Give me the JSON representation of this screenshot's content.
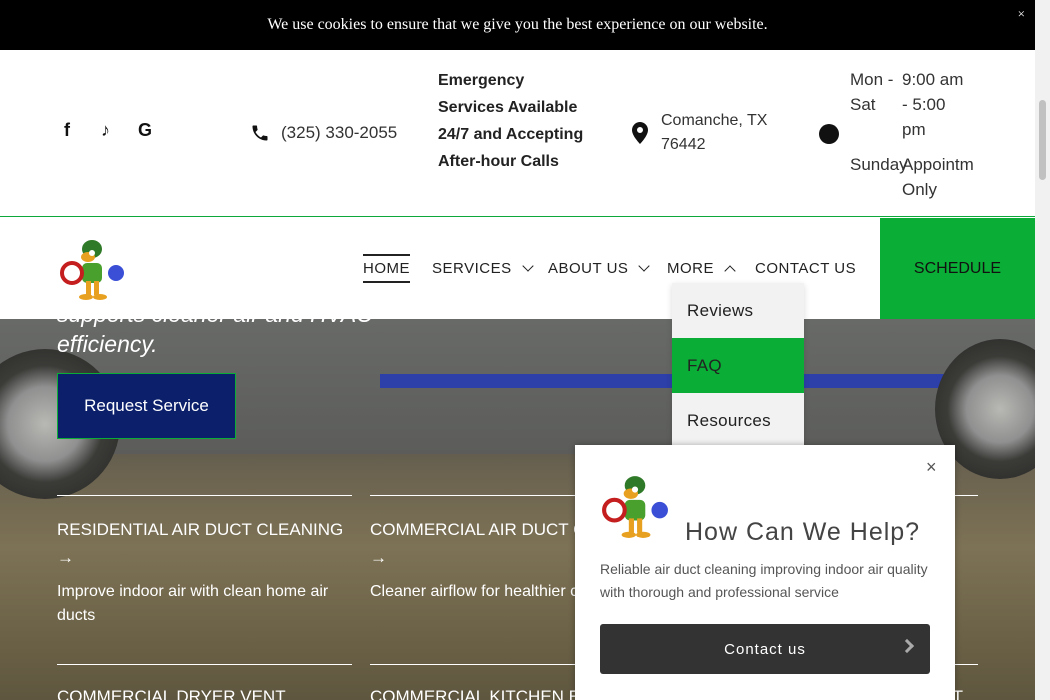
{
  "cookie": {
    "message": "We use cookies to ensure that we give you the best experience on our website.",
    "close": "×"
  },
  "info": {
    "social_icons": [
      "facebook-icon",
      "tiktok-icon",
      "google-icon"
    ],
    "social_glyphs": [
      "f",
      "♪",
      "G"
    ],
    "phone": "(325) 330-2055",
    "emergency": "Emergency Services Available 24/7 and Accepting After-hour Calls",
    "location": "Comanche, TX 76442",
    "hours": {
      "days1": "Mon - Sat",
      "time1": "9:00 am - 5:00 pm",
      "days2": "Sunday",
      "time2": "Appointm",
      "time2b": "Only"
    }
  },
  "nav": {
    "items": [
      {
        "label": "HOME",
        "active": true
      },
      {
        "label": "SERVICES"
      },
      {
        "label": "ABOUT US"
      },
      {
        "label": "MORE"
      },
      {
        "label": "CONTACT US"
      }
    ],
    "schedule": "SCHEDULE"
  },
  "dropdown": {
    "items": [
      "Reviews",
      "FAQ",
      "Resources"
    ]
  },
  "hero": {
    "tagline_line1": "supports cleaner air and HVAC",
    "tagline_line2": "efficiency.",
    "request_button": "Request Service",
    "services": [
      {
        "title": "RESIDENTIAL AIR DUCT CLEANING",
        "arrow": "→",
        "desc": "Improve indoor air with clean home air ducts"
      },
      {
        "title": "COMMERCIAL AIR DUCT C",
        "arrow": "→",
        "desc": "Cleaner airflow for healthier c spaces"
      }
    ],
    "services_row2": [
      "COMMERCIAL DRYER VENT",
      "COMMERCIAL KITCHEN E",
      "T"
    ]
  },
  "popup": {
    "close": "×",
    "title": "How Can We Help?",
    "description": "Reliable air duct cleaning improving indoor air quality with thorough and professional service",
    "button": "Contact us"
  },
  "colors": {
    "accent_green": "#0aad36",
    "navy": "#0b1f6b",
    "cookie_bg": "#000000"
  }
}
